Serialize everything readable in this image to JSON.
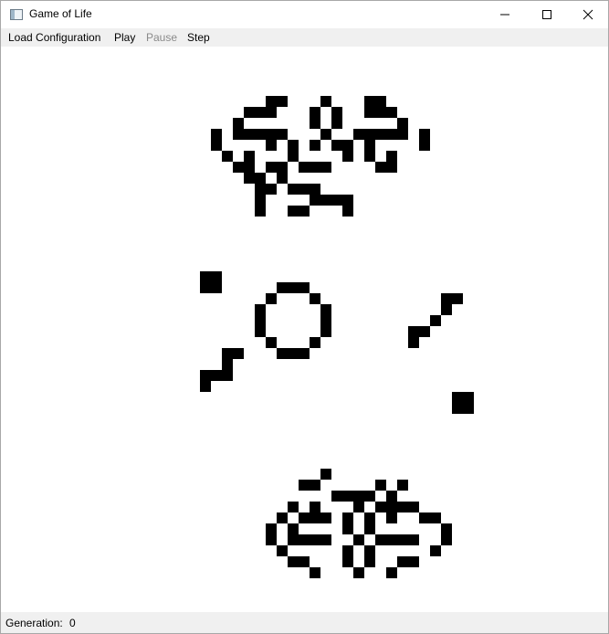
{
  "window": {
    "title": "Game of Life",
    "controls": {
      "minimize_icon": "minimize-icon",
      "maximize_icon": "maximize-icon",
      "close_icon": "close-icon"
    }
  },
  "menu": {
    "items": [
      {
        "label": "Load Configuration",
        "enabled": true
      },
      {
        "label": "Play",
        "enabled": true
      },
      {
        "label": "Pause",
        "enabled": false
      },
      {
        "label": "Step",
        "enabled": true
      }
    ]
  },
  "status": {
    "generation_label": "Generation:",
    "generation_value": "0"
  },
  "colors": {
    "live_cell": "#000000",
    "dead_cell": "#ffffff",
    "menubar": "#f0f0f0",
    "disabled_text": "#8a8a8a"
  },
  "board": {
    "live_cell_runs": [
      [
        0,
        9,
        2
      ],
      [
        0,
        14,
        1
      ],
      [
        0,
        18,
        2
      ],
      [
        1,
        7,
        3
      ],
      [
        1,
        13,
        1
      ],
      [
        1,
        15,
        1
      ],
      [
        1,
        18,
        3
      ],
      [
        2,
        6,
        1
      ],
      [
        2,
        13,
        1
      ],
      [
        2,
        15,
        1
      ],
      [
        2,
        21,
        1
      ],
      [
        3,
        4,
        1
      ],
      [
        3,
        6,
        5
      ],
      [
        3,
        14,
        1
      ],
      [
        3,
        17,
        5
      ],
      [
        3,
        23,
        1
      ],
      [
        4,
        4,
        1
      ],
      [
        4,
        9,
        1
      ],
      [
        4,
        11,
        1
      ],
      [
        4,
        13,
        1
      ],
      [
        4,
        15,
        2
      ],
      [
        4,
        18,
        1
      ],
      [
        4,
        23,
        1
      ],
      [
        5,
        5,
        1
      ],
      [
        5,
        7,
        1
      ],
      [
        5,
        11,
        1
      ],
      [
        5,
        16,
        1
      ],
      [
        5,
        18,
        1
      ],
      [
        5,
        20,
        1
      ],
      [
        6,
        6,
        2
      ],
      [
        6,
        9,
        2
      ],
      [
        6,
        12,
        3
      ],
      [
        6,
        19,
        2
      ],
      [
        7,
        7,
        2
      ],
      [
        7,
        10,
        1
      ],
      [
        8,
        8,
        2
      ],
      [
        8,
        11,
        3
      ],
      [
        9,
        8,
        1
      ],
      [
        9,
        13,
        4
      ],
      [
        10,
        8,
        1
      ],
      [
        10,
        11,
        2
      ],
      [
        10,
        16,
        1
      ],
      [
        16,
        3,
        2
      ],
      [
        17,
        3,
        2
      ],
      [
        17,
        10,
        3
      ],
      [
        18,
        9,
        1
      ],
      [
        18,
        13,
        1
      ],
      [
        18,
        25,
        2
      ],
      [
        19,
        8,
        1
      ],
      [
        19,
        14,
        1
      ],
      [
        19,
        25,
        1
      ],
      [
        20,
        8,
        1
      ],
      [
        20,
        14,
        1
      ],
      [
        20,
        24,
        1
      ],
      [
        21,
        8,
        1
      ],
      [
        21,
        14,
        1
      ],
      [
        21,
        22,
        2
      ],
      [
        22,
        9,
        1
      ],
      [
        22,
        13,
        1
      ],
      [
        22,
        22,
        1
      ],
      [
        23,
        5,
        2
      ],
      [
        23,
        10,
        3
      ],
      [
        24,
        5,
        1
      ],
      [
        25,
        3,
        3
      ],
      [
        26,
        3,
        1
      ],
      [
        27,
        26,
        2
      ],
      [
        28,
        26,
        2
      ],
      [
        34,
        14,
        1
      ],
      [
        35,
        12,
        2
      ],
      [
        35,
        19,
        1
      ],
      [
        35,
        21,
        1
      ],
      [
        36,
        15,
        4
      ],
      [
        36,
        20,
        1
      ],
      [
        37,
        11,
        1
      ],
      [
        37,
        13,
        1
      ],
      [
        37,
        17,
        1
      ],
      [
        37,
        19,
        3
      ],
      [
        37,
        22,
        1
      ],
      [
        38,
        10,
        1
      ],
      [
        38,
        12,
        3
      ],
      [
        38,
        16,
        1
      ],
      [
        38,
        18,
        1
      ],
      [
        38,
        20,
        1
      ],
      [
        38,
        23,
        2
      ],
      [
        39,
        9,
        1
      ],
      [
        39,
        11,
        1
      ],
      [
        39,
        16,
        1
      ],
      [
        39,
        18,
        1
      ],
      [
        39,
        25,
        1
      ],
      [
        40,
        9,
        1
      ],
      [
        40,
        11,
        4
      ],
      [
        40,
        17,
        1
      ],
      [
        40,
        19,
        4
      ],
      [
        40,
        25,
        1
      ],
      [
        41,
        10,
        1
      ],
      [
        41,
        16,
        1
      ],
      [
        41,
        18,
        1
      ],
      [
        41,
        24,
        1
      ],
      [
        42,
        11,
        2
      ],
      [
        42,
        16,
        1
      ],
      [
        42,
        18,
        1
      ],
      [
        42,
        21,
        2
      ],
      [
        43,
        13,
        1
      ],
      [
        43,
        17,
        1
      ],
      [
        43,
        20,
        1
      ]
    ]
  }
}
